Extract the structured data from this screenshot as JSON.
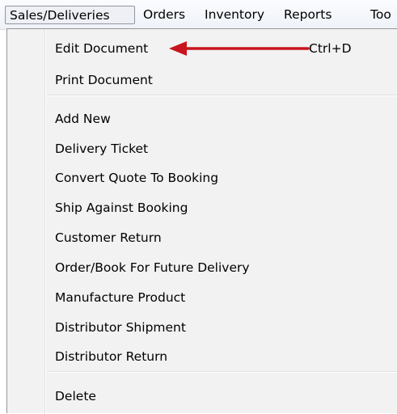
{
  "menubar": {
    "items": [
      "Sales/Deliveries",
      "Orders",
      "Inventory",
      "Reports",
      "Too"
    ],
    "active": "Sales/Deliveries"
  },
  "menu": {
    "edit_document": {
      "label": "Edit Document",
      "shortcut": "Ctrl+D"
    },
    "print_document": "Print Document",
    "add_new": "Add New",
    "delivery_ticket": "Delivery Ticket",
    "convert_quote": "Convert Quote To Booking",
    "ship_against_booking": "Ship Against Booking",
    "customer_return": "Customer Return",
    "order_future": "Order/Book For Future Delivery",
    "manufacture_product": "Manufacture Product",
    "distributor_shipment": "Distributor Shipment",
    "distributor_return": "Distributor Return",
    "delete": "Delete"
  },
  "annotation": {
    "icon": "red-arrow-icon",
    "color": "#c8141e"
  }
}
